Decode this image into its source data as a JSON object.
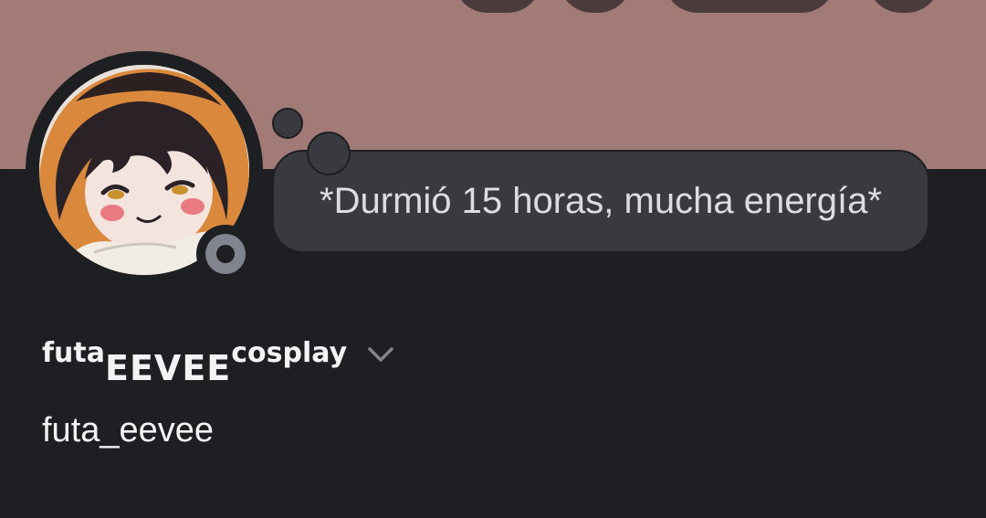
{
  "profile": {
    "banner_color": "#a27a76",
    "status_text": "*Durmió 15 horas, mucha energía*",
    "display_name": {
      "part_1": "futa",
      "part_2": "EEVEE",
      "part_3": "cosplay"
    },
    "username": "futa_eevee",
    "presence_status": "offline"
  },
  "icons": {
    "avatar": "anime-avatar-image",
    "presence": "offline-status-icon",
    "expand": "chevron-down-icon"
  }
}
